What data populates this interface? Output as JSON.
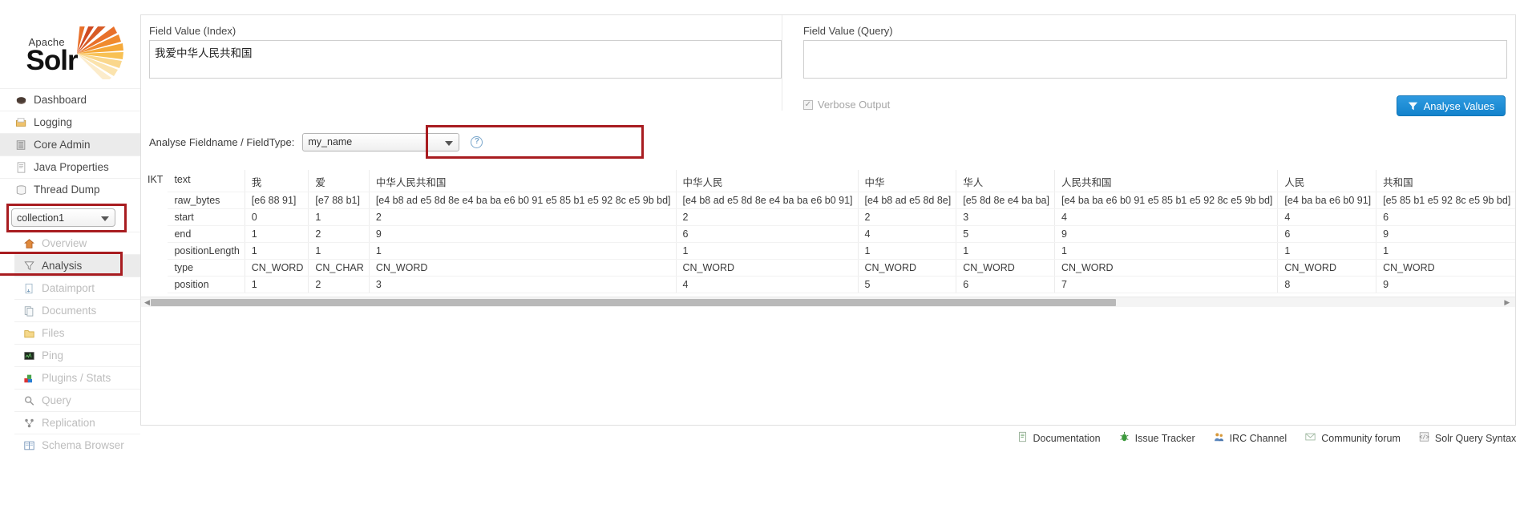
{
  "brand": {
    "apache": "Apache",
    "solr": "Solr"
  },
  "sidebar": {
    "main_items": [
      {
        "label": "Dashboard",
        "icon": "dashboard-icon",
        "active": false
      },
      {
        "label": "Logging",
        "icon": "logging-icon",
        "active": false
      },
      {
        "label": "Core Admin",
        "icon": "core-admin-icon",
        "active": true
      },
      {
        "label": "Java Properties",
        "icon": "java-properties-icon",
        "active": false
      },
      {
        "label": "Thread Dump",
        "icon": "thread-dump-icon",
        "active": false
      }
    ],
    "collection": {
      "value": "collection1",
      "caret": "chevron-down-icon"
    },
    "core_items": [
      {
        "label": "Overview",
        "icon": "home-icon",
        "active": false
      },
      {
        "label": "Analysis",
        "icon": "funnel-icon",
        "active": true
      },
      {
        "label": "Dataimport",
        "icon": "dataimport-icon",
        "active": false
      },
      {
        "label": "Documents",
        "icon": "documents-icon",
        "active": false
      },
      {
        "label": "Files",
        "icon": "files-icon",
        "active": false
      },
      {
        "label": "Ping",
        "icon": "ping-icon",
        "active": false
      },
      {
        "label": "Plugins / Stats",
        "icon": "plugins-icon",
        "active": false
      },
      {
        "label": "Query",
        "icon": "magnifier-icon",
        "active": false
      },
      {
        "label": "Replication",
        "icon": "replication-icon",
        "active": false
      },
      {
        "label": "Schema Browser",
        "icon": "book-icon",
        "active": false
      }
    ]
  },
  "form": {
    "index_label": "Field Value (Index)",
    "index_value": "我爱中华人民共和国",
    "query_label": "Field Value (Query)",
    "query_value": "",
    "analyse_label": "Analyse Fieldname / FieldType:",
    "fieldname_value": "my_name",
    "help_glyph": "?",
    "verbose_label": "Verbose Output",
    "verbose_checked": true,
    "analyse_button": "Analyse Values",
    "analyse_button_icon": "funnel-icon"
  },
  "analysis": {
    "tokenizer": "IKT",
    "row_labels": [
      "text",
      "raw_bytes",
      "start",
      "end",
      "positionLength",
      "type",
      "position"
    ],
    "tokens": [
      {
        "text": "我",
        "raw_bytes": "[e6 88 91]",
        "start": "0",
        "end": "1",
        "positionLength": "1",
        "type": "CN_WORD",
        "position": "1"
      },
      {
        "text": "爱",
        "raw_bytes": "[e7 88 b1]",
        "start": "1",
        "end": "2",
        "positionLength": "1",
        "type": "CN_CHAR",
        "position": "2"
      },
      {
        "text": "中华人民共和国",
        "raw_bytes": "[e4 b8 ad e5 8d 8e e4 ba ba e6 b0 91 e5 85 b1 e5 92 8c e5 9b bd]",
        "start": "2",
        "end": "9",
        "positionLength": "1",
        "type": "CN_WORD",
        "position": "3"
      },
      {
        "text": "中华人民",
        "raw_bytes": "[e4 b8 ad e5 8d 8e e4 ba ba e6 b0 91]",
        "start": "2",
        "end": "6",
        "positionLength": "1",
        "type": "CN_WORD",
        "position": "4"
      },
      {
        "text": "中华",
        "raw_bytes": "[e4 b8 ad e5 8d 8e]",
        "start": "2",
        "end": "4",
        "positionLength": "1",
        "type": "CN_WORD",
        "position": "5"
      },
      {
        "text": "华人",
        "raw_bytes": "[e5 8d 8e e4 ba ba]",
        "start": "3",
        "end": "5",
        "positionLength": "1",
        "type": "CN_WORD",
        "position": "6"
      },
      {
        "text": "人民共和国",
        "raw_bytes": "[e4 ba ba e6 b0 91 e5 85 b1 e5 92 8c e5 9b bd]",
        "start": "4",
        "end": "9",
        "positionLength": "1",
        "type": "CN_WORD",
        "position": "7"
      },
      {
        "text": "人民",
        "raw_bytes": "[e4 ba ba e6 b0 91]",
        "start": "4",
        "end": "6",
        "positionLength": "1",
        "type": "CN_WORD",
        "position": "8"
      },
      {
        "text": "共和国",
        "raw_bytes": "[e5 85 b1 e5 92 8c e5 9b bd]",
        "start": "6",
        "end": "9",
        "positionLength": "1",
        "type": "CN_WORD",
        "position": "9"
      }
    ]
  },
  "footer": {
    "links": [
      {
        "label": "Documentation",
        "icon": "document-icon"
      },
      {
        "label": "Issue Tracker",
        "icon": "bug-icon"
      },
      {
        "label": "IRC Channel",
        "icon": "people-icon"
      },
      {
        "label": "Community forum",
        "icon": "envelope-icon"
      },
      {
        "label": "Solr Query Syntax",
        "icon": "code-icon"
      }
    ]
  },
  "colors": {
    "accent_blue": "#1383cc",
    "highlight_red": "#a81c20",
    "active_bg": "#ebebeb"
  }
}
